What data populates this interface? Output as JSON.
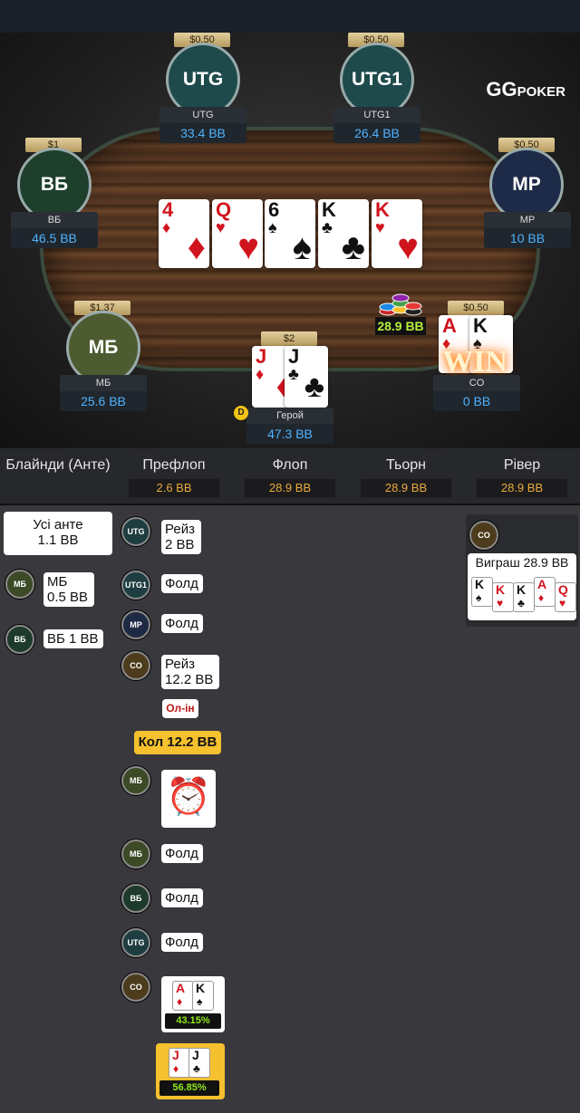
{
  "app": {
    "logo_main": "GG",
    "logo_sub": "POKER"
  },
  "board": [
    {
      "rank": "4",
      "suit": "♦",
      "color": "red"
    },
    {
      "rank": "Q",
      "suit": "♥",
      "color": "red"
    },
    {
      "rank": "6",
      "suit": "♠",
      "color": "blk"
    },
    {
      "rank": "K",
      "suit": "♣",
      "color": "blk"
    },
    {
      "rank": "K",
      "suit": "♥",
      "color": "red"
    }
  ],
  "pot": "28.9 BB",
  "win_label": "WIN",
  "dealer_label": "D",
  "seats": {
    "utg": {
      "avatar": "UTG",
      "bet": "$0.50",
      "name": "UTG",
      "stack": "33.4 BB"
    },
    "utg1": {
      "avatar": "UTG1",
      "bet": "$0.50",
      "name": "UTG1",
      "stack": "26.4 BB"
    },
    "vb": {
      "avatar": "ВБ",
      "bet": "$1",
      "name": "ВБ",
      "stack": "46.5 BB"
    },
    "mp": {
      "avatar": "MP",
      "bet": "$0.50",
      "name": "MP",
      "stack": "10 BB"
    },
    "mb": {
      "avatar": "МБ",
      "bet": "$1.37",
      "name": "МБ",
      "stack": "25.6 BB"
    },
    "hero": {
      "bet": "$2",
      "name": "Герой",
      "stack": "47.3 BB",
      "cards": [
        {
          "rank": "J",
          "suit": "♦",
          "color": "red"
        },
        {
          "rank": "J",
          "suit": "♣",
          "color": "blk"
        }
      ]
    },
    "co": {
      "bet": "$0.50",
      "name": "CO",
      "stack": "0 BB",
      "cards": [
        {
          "rank": "A",
          "suit": "♦",
          "color": "red"
        },
        {
          "rank": "K",
          "suit": "♠",
          "color": "blk"
        }
      ]
    }
  },
  "history": {
    "columns": [
      {
        "title": "Блайнди (Анте)",
        "pot": ""
      },
      {
        "title": "Префлоп",
        "pot": "2.6 BB"
      },
      {
        "title": "Флоп",
        "pot": "28.9 BB"
      },
      {
        "title": "Тьорн",
        "pot": "28.9 BB"
      },
      {
        "title": "Рівер",
        "pot": "28.9 BB"
      }
    ],
    "blinds": {
      "ante_l1": "Усі анте",
      "ante_l2": "1.1 BB",
      "mb_token": "МБ",
      "mb_l1": "МБ",
      "mb_l2": "0.5 BB",
      "vb_token": "ВБ",
      "vb_text": "ВБ 1 BB"
    },
    "preflop": {
      "utg_token": "UTG",
      "utg_l1": "Рейз",
      "utg_l2": "2 BB",
      "utg1_token": "UTG1",
      "utg1_action": "Фолд",
      "mp_token": "MP",
      "mp_action": "Фолд",
      "co_token": "CO",
      "co_l1": "Рейз",
      "co_l2": "12.2 BB",
      "co_allin": "Ол-ін",
      "call": "Кол 12.2 BB",
      "mb_token": "МБ",
      "timer": "⏰",
      "mb2_token": "МБ",
      "mb2_action": "Фолд",
      "vb_token": "ВБ",
      "vb_action": "Фолд",
      "utg2_token": "UTG",
      "utg2_action": "Фолд",
      "co2_token": "CO",
      "co_cards": [
        {
          "rank": "A",
          "suit": "♦",
          "color": "red"
        },
        {
          "rank": "K",
          "suit": "♠",
          "color": "blk"
        }
      ],
      "co_equity": "43.15%",
      "hero_cards": [
        {
          "rank": "J",
          "suit": "♦",
          "color": "red"
        },
        {
          "rank": "J",
          "suit": "♣",
          "color": "blk"
        }
      ],
      "hero_equity": "56.85%"
    },
    "river": {
      "co_token": "CO",
      "win_text": "Виграш 28.9 BB",
      "cards": [
        {
          "rank": "K",
          "suit": "♠",
          "color": "blk"
        },
        {
          "rank": "K",
          "suit": "♥",
          "color": "red"
        },
        {
          "rank": "K",
          "suit": "♣",
          "color": "blk"
        },
        {
          "rank": "A",
          "suit": "♦",
          "color": "red"
        },
        {
          "rank": "Q",
          "suit": "♥",
          "color": "red"
        }
      ]
    }
  }
}
